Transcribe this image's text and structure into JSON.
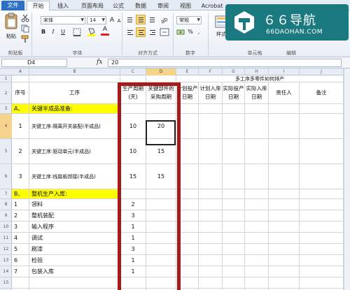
{
  "tabs": [
    "文件",
    "开始",
    "插入",
    "页面布局",
    "公式",
    "数据",
    "审阅",
    "视图",
    "Acrobat"
  ],
  "ribbon": {
    "paste_label": "粘贴",
    "font_name": "宋体",
    "font_size": "14",
    "number_format": "常规",
    "styles_label": "样式",
    "groups": [
      "剪贴板",
      "字体",
      "对齐方式",
      "数字",
      "单元格",
      "编辑"
    ]
  },
  "formula_bar": {
    "name_box": "D4",
    "fx": "fx",
    "value": "20"
  },
  "columns": [
    "A",
    "B",
    "C",
    "D",
    "E",
    "F",
    "G",
    "H",
    "I",
    "J"
  ],
  "rows": [
    "1",
    "2",
    "3",
    "4",
    "5",
    "6",
    "7",
    "8",
    "9",
    "10",
    "11",
    "12",
    "13",
    "14",
    "15",
    "16"
  ],
  "sheet": {
    "banner": "多工序多零件如何排产",
    "headers": [
      "序号",
      "工序",
      "生产周期(天)",
      "关键部件的采购周期",
      "计划投产日期",
      "计划入库日期",
      "实际投产日期",
      "实际入库日期",
      "责任人",
      "备注"
    ],
    "section_a": {
      "code": "A、",
      "title": "关键半成品准备:"
    },
    "section_b": {
      "code": "B、",
      "title": "整机生产入库:"
    },
    "key_items": [
      {
        "no": "1",
        "name": "关键工序:隔离开关装配(半成品)",
        "cycle": "10",
        "purchase": "20"
      },
      {
        "no": "2",
        "name": "关键工序:驱动单元(半成品)",
        "cycle": "10",
        "purchase": "15"
      },
      {
        "no": "3",
        "name": "关键工序:线路板焊接(半成品)",
        "cycle": "15",
        "purchase": "15"
      }
    ],
    "assembly_items": [
      {
        "no": "1",
        "name": "领料",
        "cycle": "2"
      },
      {
        "no": "2",
        "name": "整机装配",
        "cycle": "3"
      },
      {
        "no": "3",
        "name": "输入程序",
        "cycle": "1"
      },
      {
        "no": "4",
        "name": "调试",
        "cycle": "1"
      },
      {
        "no": "5",
        "name": "刷漆",
        "cycle": "3"
      },
      {
        "no": "6",
        "name": "检验",
        "cycle": "1"
      },
      {
        "no": "7",
        "name": "包装入库",
        "cycle": "1"
      }
    ]
  },
  "logo": {
    "title": "６６导航",
    "subtitle": "66DAOHAN.COM"
  },
  "colors": {
    "highlight": "#ffff00",
    "annotation": "#a31b1b",
    "file_tab": "#2c6fc4",
    "logo_bg": "#1a7a7f"
  }
}
